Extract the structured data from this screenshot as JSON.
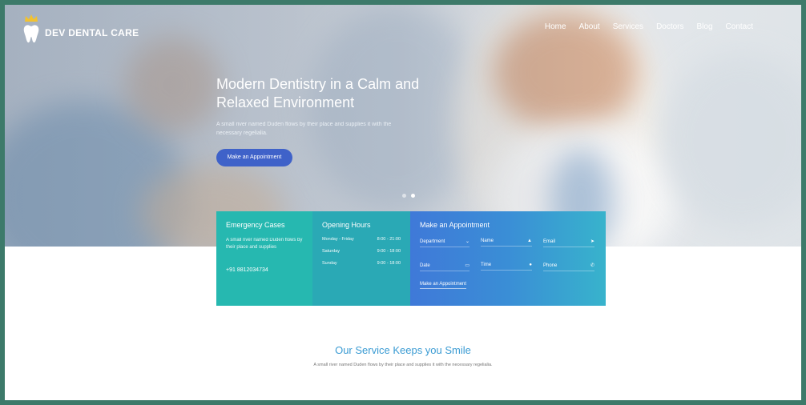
{
  "brand": {
    "name": "DEV DENTAL CARE"
  },
  "nav": [
    "Home",
    "About",
    "Services",
    "Doctors",
    "Blog",
    "Contact"
  ],
  "hero": {
    "title": "Modern Dentistry in a Calm and Relaxed Environment",
    "subtitle": "A small river named Duden flows by their place and supplies it with the necessary regelialia.",
    "cta": "Make an Appointment",
    "slides": 2,
    "active_slide": 2
  },
  "emergency": {
    "title": "Emergency Cases",
    "text": "A small river named Duden flows by their place and supplies",
    "phone": "+91 8812034734"
  },
  "hours": {
    "title": "Opening Hours",
    "rows": [
      {
        "day": "Monday - Friday",
        "time": "8:00 - 21:00"
      },
      {
        "day": "Saturday",
        "time": "9:00 - 18:00"
      },
      {
        "day": "Sunday",
        "time": "9:00 - 18:00"
      }
    ]
  },
  "appointment": {
    "title": "Make an Appointment",
    "department": "Department",
    "name": "Name",
    "email": "Email",
    "date": "Date",
    "time": "Time",
    "phone": "Phone",
    "submit": "Make an Appointment"
  },
  "service": {
    "title": "Our Service Keeps you Smile",
    "subtitle": "A small river named Duden flows by their place and supplies it with the necessary regelialia."
  },
  "colors": {
    "teal": "#26b8b0",
    "blue": "#3f62c9",
    "accent": "#3a9bd3"
  }
}
